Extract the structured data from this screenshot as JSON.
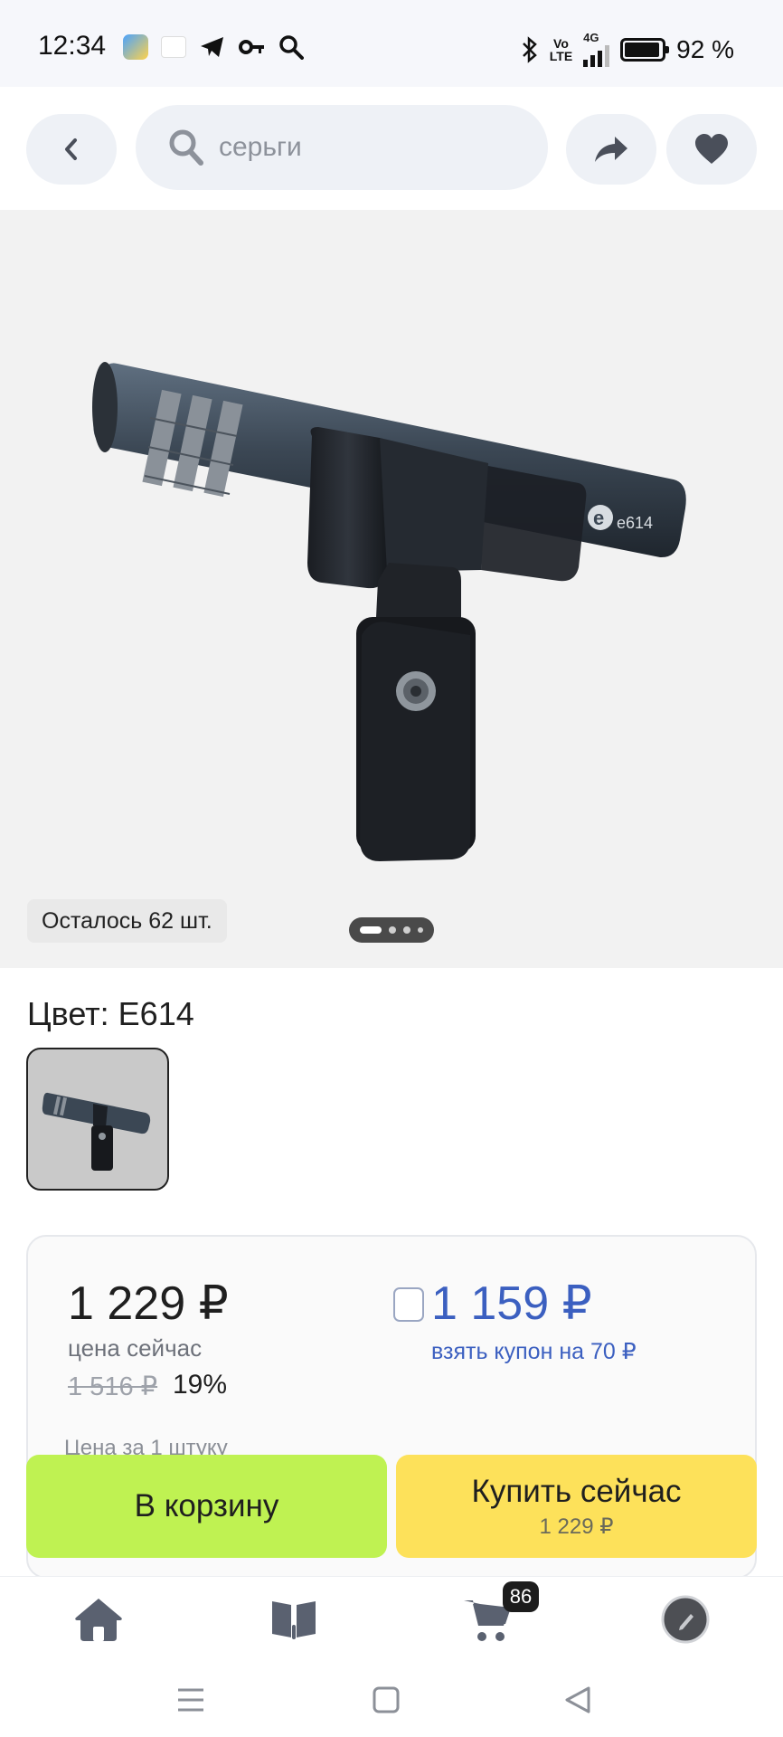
{
  "status_bar": {
    "time": "12:34",
    "network_label": "4G",
    "volte_label_top": "Vo",
    "volte_label_bottom": "LTE",
    "battery_percent": "92 %",
    "icons": [
      "weather-icon",
      "app-icon",
      "telegram-icon",
      "key-icon",
      "search-icon",
      "bluetooth-icon",
      "signal-icon",
      "battery-icon"
    ]
  },
  "header": {
    "search_placeholder": "серьги",
    "back_icon": "chevron-left-icon",
    "share_icon": "share-arrow-icon",
    "favorite_icon": "heart-icon"
  },
  "gallery": {
    "stock_text": "Осталось 62 шт.",
    "slide_count": 4,
    "active_slide": 1,
    "product_marking": "e614"
  },
  "color": {
    "title": "Цвет: E614"
  },
  "price": {
    "current": "1 229 ₽",
    "current_label": "цена сейчас",
    "old": "1 516 ₽",
    "discount": "19%",
    "coupon_price": "1 159 ₽",
    "coupon_label": "взять купон на 70 ₽",
    "per_unit_label": "Цена за 1 штуку"
  },
  "actions": {
    "cart_label": "В корзину",
    "buy_label": "Купить сейчас",
    "buy_sub_label": "1 229 ₽"
  },
  "tabbar": {
    "cart_badge": "86",
    "items": [
      "home-icon",
      "catalog-icon",
      "cart-icon",
      "profile-icon"
    ]
  },
  "colors": {
    "accent_blue": "#3b5fc0",
    "cart_button": "#bff252",
    "buy_button": "#fde15a",
    "chip_bg": "#eef1f6"
  }
}
